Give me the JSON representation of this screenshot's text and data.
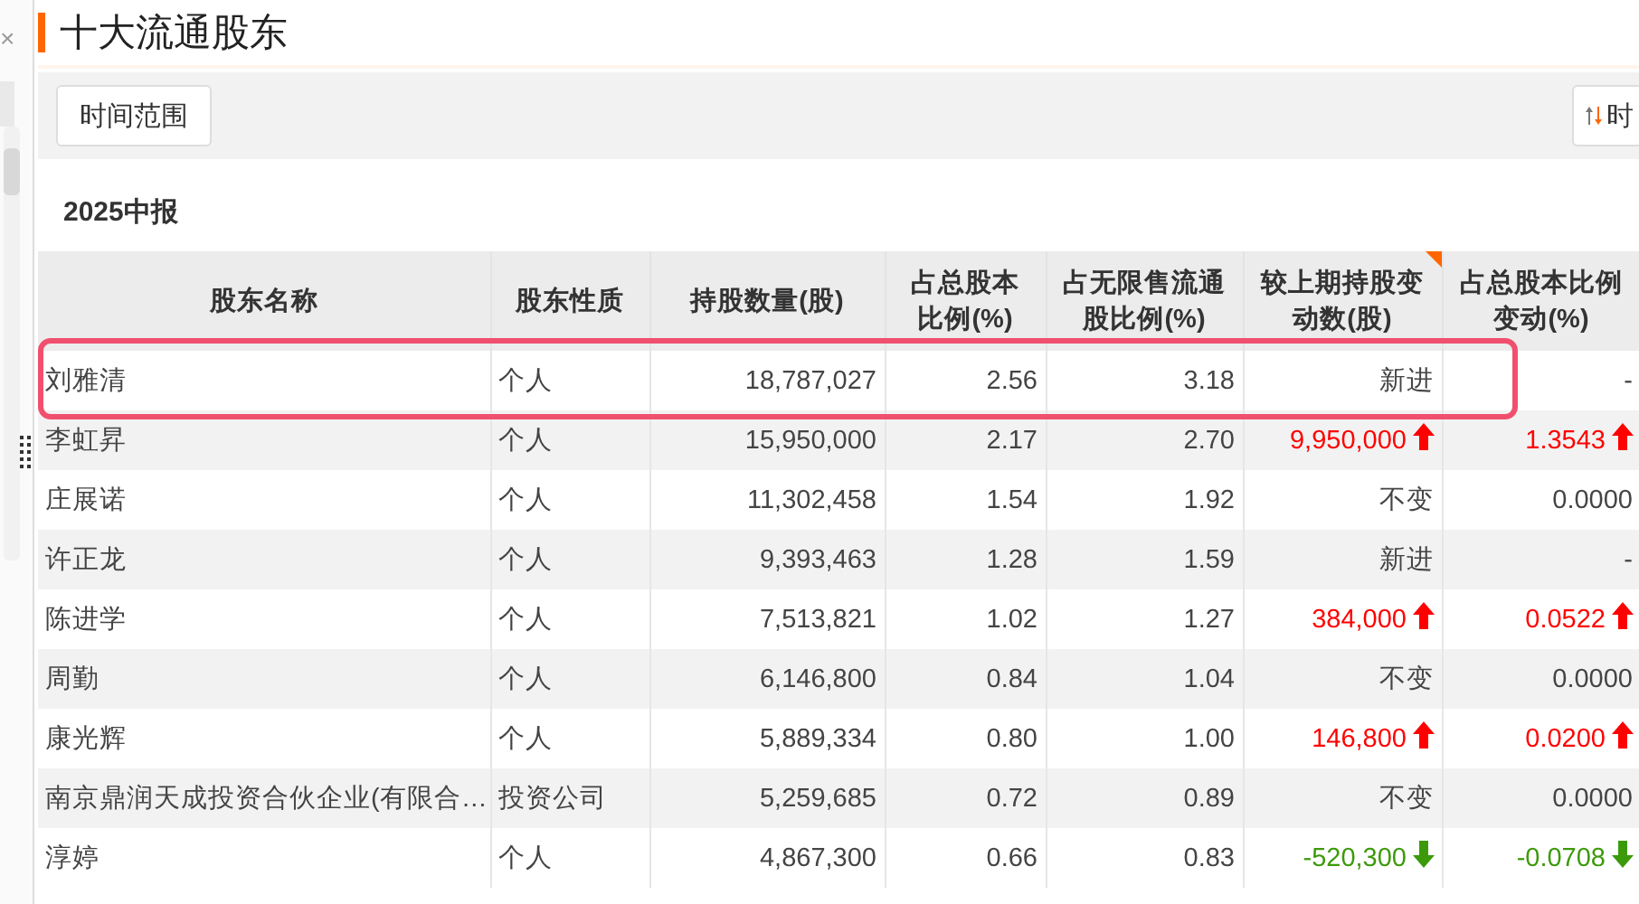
{
  "side_strip": {
    "close_glyph": "×"
  },
  "section": {
    "title": "十大流通股东"
  },
  "toolbar": {
    "range_button": "时间范围",
    "sort_button": "时"
  },
  "period": "2025中报",
  "table": {
    "columns": [
      "股东名称",
      "股东性质",
      "持股数量(股)",
      "占总股本比例(%)",
      "占无限售流通股比例(%)",
      "较上期持股变动数(股)",
      "占总股本比例变动(%)"
    ],
    "rows": [
      {
        "name": "刘雅清",
        "type": "个人",
        "shares": "18,787,027",
        "pct_total": "2.56",
        "pct_float": "3.18",
        "change": "新进",
        "change_pct": "-",
        "rising": false,
        "falling": false,
        "highlighted": true
      },
      {
        "name": "李虹昇",
        "type": "个人",
        "shares": "15,950,000",
        "pct_total": "2.17",
        "pct_float": "2.70",
        "change": "9,950,000",
        "change_pct": "1.3543",
        "rising": true,
        "falling": false,
        "highlighted": false
      },
      {
        "name": "庄展诺",
        "type": "个人",
        "shares": "11,302,458",
        "pct_total": "1.54",
        "pct_float": "1.92",
        "change": "不变",
        "change_pct": "0.0000",
        "rising": false,
        "falling": false,
        "highlighted": false
      },
      {
        "name": "许正龙",
        "type": "个人",
        "shares": "9,393,463",
        "pct_total": "1.28",
        "pct_float": "1.59",
        "change": "新进",
        "change_pct": "-",
        "rising": false,
        "falling": false,
        "highlighted": false
      },
      {
        "name": "陈进学",
        "type": "个人",
        "shares": "7,513,821",
        "pct_total": "1.02",
        "pct_float": "1.27",
        "change": "384,000",
        "change_pct": "0.0522",
        "rising": true,
        "falling": false,
        "highlighted": false
      },
      {
        "name": "周勤",
        "type": "个人",
        "shares": "6,146,800",
        "pct_total": "0.84",
        "pct_float": "1.04",
        "change": "不变",
        "change_pct": "0.0000",
        "rising": false,
        "falling": false,
        "highlighted": false
      },
      {
        "name": "康光辉",
        "type": "个人",
        "shares": "5,889,334",
        "pct_total": "0.80",
        "pct_float": "1.00",
        "change": "146,800",
        "change_pct": "0.0200",
        "rising": true,
        "falling": false,
        "highlighted": false
      },
      {
        "name": "南京鼎润天成投资合伙企业(有限合…",
        "type": "投资公司",
        "shares": "5,259,685",
        "pct_total": "0.72",
        "pct_float": "0.89",
        "change": "不变",
        "change_pct": "0.0000",
        "rising": false,
        "falling": false,
        "highlighted": false
      },
      {
        "name": "淳婷",
        "type": "个人",
        "shares": "4,867,300",
        "pct_total": "0.66",
        "pct_float": "0.83",
        "change": "-520,300",
        "change_pct": "-0.0708",
        "rising": false,
        "falling": true,
        "highlighted": false
      }
    ]
  }
}
